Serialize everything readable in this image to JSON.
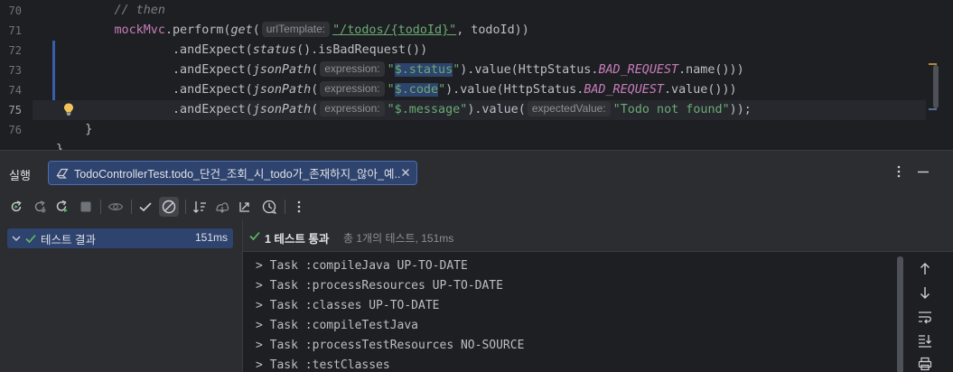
{
  "editor": {
    "line_numbers": [
      "70",
      "71",
      "72",
      "73",
      "74",
      "75",
      "76"
    ],
    "current_line": "75",
    "comment": "// then",
    "line71": {
      "field": "mockMvc",
      "perform": ".perform(",
      "get": "get",
      "paren": "(",
      "hint": "urlTemplate:",
      "url": "\"/todos/{todoId}\"",
      "rest": ", todoId))"
    },
    "line72": {
      "lead": ".andExpect(",
      "fn": "status",
      "rest": "().isBadRequest())"
    },
    "line73": {
      "lead": ".andExpect(",
      "fn": "jsonPath",
      "paren": "(",
      "hint": "expression:",
      "q1": "\"",
      "hl": "$.status",
      "q2": "\"",
      "mid": ").value(HttpStatus.",
      "const": "BAD_REQUEST",
      "rest": ".name()))"
    },
    "line74": {
      "lead": ".andExpect(",
      "fn": "jsonPath",
      "paren": "(",
      "hint": "expression:",
      "q1": "\"",
      "hl": "$.code",
      "q2": "\"",
      "mid": ").value(HttpStatus.",
      "const": "BAD_REQUEST",
      "rest": ".value()))"
    },
    "line75": {
      "lead": ".andExpect(",
      "fn": "jsonPath",
      "paren": "(",
      "hint": "expression:",
      "str": "\"$.message\"",
      "mid": ").value(",
      "hint2": "expectedValue:",
      "str2": "\"Todo not found\"",
      "rest": "));"
    },
    "line76": "}",
    "line77": "}"
  },
  "run": {
    "title": "실행",
    "tab_label": "TodoControllerTest.todo_단건_조회_시_todo가_존재하지_않아_예...",
    "toolbar_icons": [
      "rerun-icon",
      "rerun-failed-icon",
      "rerun-debug-icon",
      "stop-icon",
      "show-ignored-icon",
      "show-passed-icon",
      "show-skipped-icon",
      "sort-icon",
      "import-tests-icon",
      "export-tests-icon",
      "history-icon",
      "more-icon"
    ]
  },
  "tree": {
    "root_label": "테스트 결과",
    "root_time": "151ms"
  },
  "status": {
    "passed": "1 테스트 통과",
    "summary": "총 1개의 테스트, 151ms"
  },
  "console": {
    "lines": [
      "> Task :compileJava UP-TO-DATE",
      "> Task :processResources UP-TO-DATE",
      "> Task :classes UP-TO-DATE",
      "> Task :compileTestJava",
      "> Task :processTestResources NO-SOURCE",
      "> Task :testClasses"
    ]
  },
  "colors": {
    "accent": "#2e436e",
    "pass_green": "#5fb865",
    "string_green": "#6aab73",
    "field_purple": "#c77dbb"
  }
}
